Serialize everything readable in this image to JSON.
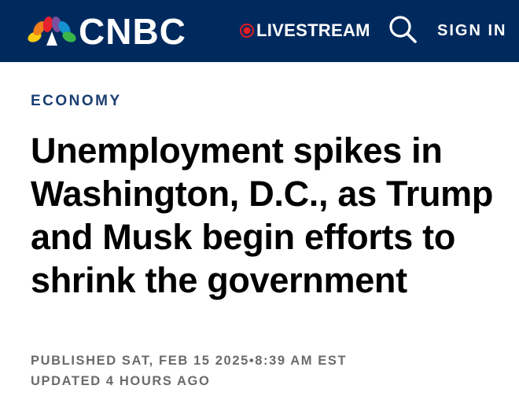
{
  "header": {
    "brand": "CNBC",
    "livestream_label": "LIVESTREAM",
    "signin_label": "SIGN IN",
    "background_color": "#002a5e",
    "live_dot_color": "#e31b23",
    "icons": {
      "logo": "nbc-peacock-icon",
      "live": "live-dot-icon",
      "search": "search-icon"
    }
  },
  "article": {
    "section": "ECONOMY",
    "headline": "Unemployment spikes in Washington, D.C., as Trump and Musk begin efforts to shrink the government",
    "published_prefix": "PUBLISHED SAT, FEB 15 2025",
    "published_time": "8:39 AM EST",
    "updated": "UPDATED 4 HOURS AGO"
  }
}
